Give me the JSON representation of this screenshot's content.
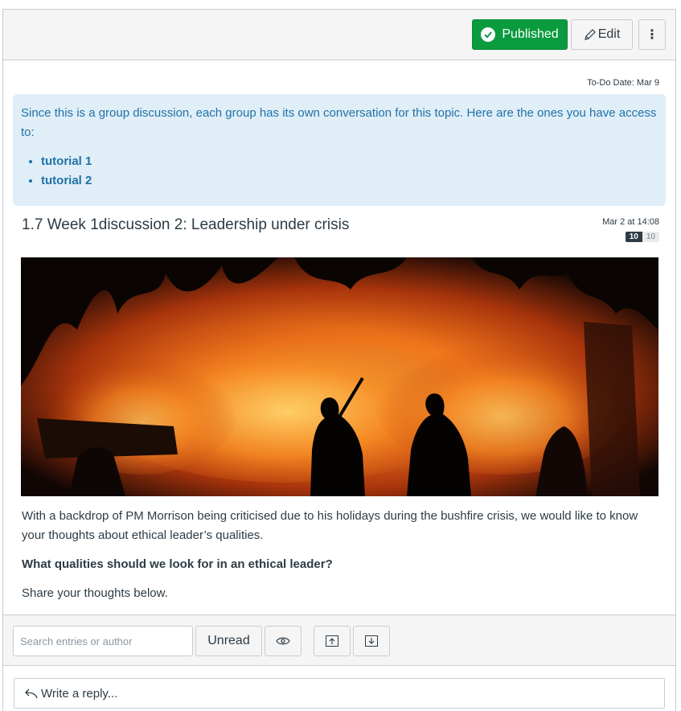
{
  "header": {
    "published_label": "Published",
    "edit_label": "Edit",
    "more_label": "⋮"
  },
  "todo_date": "To-Do Date: Mar 9",
  "group_notice": {
    "text": "Since this is a group discussion, each group has its own conversation for this topic. Here are the ones you have access to:",
    "groups": [
      "tutorial 1",
      "tutorial 2"
    ]
  },
  "discussion": {
    "title": "1.7 Week 1discussion 2: Leadership under crisis",
    "date": "Mar 2 at 14:08",
    "unread_count": "10",
    "total_count": "10",
    "paragraph1": "With a backdrop of PM Morrison being criticised due to his holidays during the bushfire crisis, we would like to know your thoughts about ethical leader’s qualities.",
    "question": "What qualities should we look for in an ethical leader?",
    "paragraph2": "Share your thoughts below."
  },
  "toolbar": {
    "search_placeholder": "Search entries or author",
    "unread_label": "Unread"
  },
  "reply": {
    "label": "Write a reply..."
  },
  "colors": {
    "published_green": "#0b9b3f",
    "link_blue": "#1f72a8",
    "info_bg": "#e0eef7"
  },
  "icons": [
    "check-circle-icon",
    "pencil-icon",
    "kebab-icon",
    "eye-icon",
    "collapse-up-icon",
    "expand-down-icon",
    "reply-arrow-icon"
  ]
}
